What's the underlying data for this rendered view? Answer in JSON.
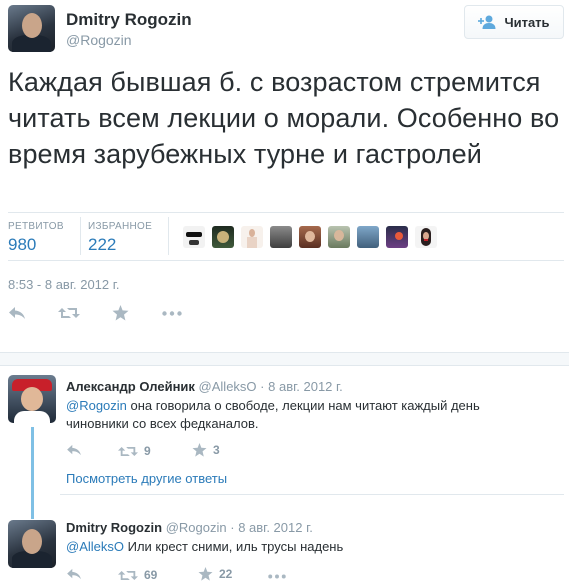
{
  "author": {
    "name": "Dmitry Rogozin",
    "handle": "@Rogozin"
  },
  "follow_button": {
    "label": "Читать",
    "icon": "add-person-icon"
  },
  "tweet": {
    "text": "Каждая бывшая б. с возрастом стремится читать всем лекции о морали. Особенно во время зарубежных турне и гастролей",
    "timestamp": "8:53 - 8 авг. 2012 г."
  },
  "stats": {
    "retweets_label": "РЕТВИТОВ",
    "retweets_value": "980",
    "favorites_label": "ИЗБРАННОЕ",
    "favorites_value": "222"
  },
  "actions": {
    "reply_icon": "reply-icon",
    "retweet_icon": "retweet-icon",
    "favorite_icon": "star-icon",
    "more_icon": "more-icon"
  },
  "replies": [
    {
      "name": "Александр Олейник",
      "handle": "@AlleksO",
      "date": "8 авг. 2012 г.",
      "mention": "@Rogozin",
      "text": " она говорила о свободе, лекции нам читают каждый день чиновники со всех федканалов.",
      "retweets": "9",
      "favorites": "3"
    },
    {
      "name": "Dmitry Rogozin",
      "handle": "@Rogozin",
      "date": "8 авг. 2012 г.",
      "mention": "@AlleksO",
      "text": " Или крест сними, иль трусы надень",
      "retweets": "69",
      "favorites": "22"
    }
  ],
  "more_replies_link": "Посмотреть другие ответы",
  "colors": {
    "link": "#2b7bb9",
    "muted": "#8899a6",
    "icon": "#aab8c2",
    "divider": "#e1e8ed"
  }
}
